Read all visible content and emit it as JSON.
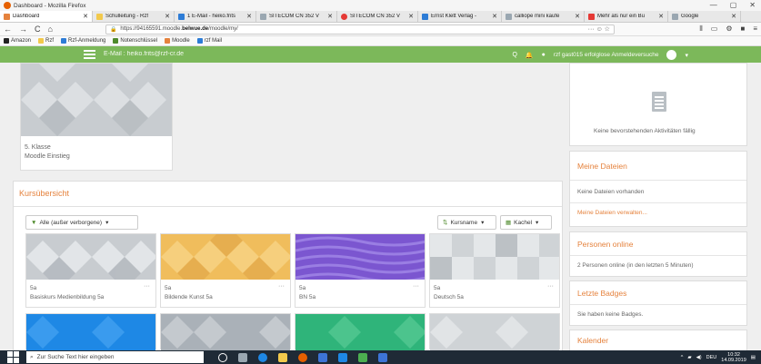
{
  "window": {
    "title": "Dashboard - Mozilla Firefox",
    "controls": [
      "—",
      "▢",
      "✕"
    ]
  },
  "tabs": [
    {
      "label": "Dashboard",
      "color": "#e8e8e8",
      "active": true
    },
    {
      "label": "Schulleitung - Rzf",
      "color": "#f2c94c"
    },
    {
      "label": "1 E-Mail - heiko.frits",
      "color": "#2d7cd6"
    },
    {
      "label": "SITECOM CN 352 V",
      "color": "#9aa7b1"
    },
    {
      "label": "SITECOM CN 352 V",
      "color": "#e53935"
    },
    {
      "label": "Ernst Klett Verlag -",
      "color": "#2d7cd6"
    },
    {
      "label": "calliope mini kaufe",
      "color": "#9aa7b1"
    },
    {
      "label": "Mehr als nur ein Bu",
      "color": "#e53935"
    },
    {
      "label": "Google",
      "color": "#9aa7b1"
    }
  ],
  "nav": {
    "back": "←",
    "forward": "→",
    "reload": "C",
    "home": "⌂",
    "url_prefix": "https://94165591.moodle.",
    "url_domain": "belwue.de",
    "url_suffix": "/moodle/my/",
    "url_ext": "··· ☺ ☆",
    "right_icons": [
      "⫴",
      "▭",
      "⚙",
      "■",
      "≡"
    ]
  },
  "bookmarks": [
    {
      "label": "Amazon",
      "color": "#222"
    },
    {
      "label": "Rzf",
      "color": "#f2c94c"
    },
    {
      "label": "Rzf-Anmeldung",
      "color": "#2d7cd6"
    },
    {
      "label": "Notenschlüssel",
      "color": "#4e8a2b"
    },
    {
      "label": "Moodle",
      "color": "#e5823d"
    },
    {
      "label": "rzf Mail",
      "color": "#2d7cd6"
    }
  ],
  "header": {
    "mail": "E-Mail : heiko.frits@rzf-cr.de",
    "user": "rzf gast015   erfolglose Anmeldeversuche",
    "search_icon": "Q",
    "bell_icon": "🔔",
    "chat_icon": "●",
    "dropdown": "▾"
  },
  "card5": {
    "line1": "5. Klasse",
    "line2": "Moodle Einstieg"
  },
  "overview": {
    "title": "Kursübersicht",
    "filter": "Alle (außer verborgene)",
    "sort": "Kursname",
    "view": "Kachel",
    "caret": "▾",
    "courses": [
      {
        "label1": "5a",
        "label2": "Basiskurs Medienbildung 5a",
        "color": "#c8ccd0",
        "pattern": "diamond"
      },
      {
        "label1": "5a",
        "label2": "Bildende Kunst 5a",
        "color": "#f0bd5c",
        "pattern": "diamond"
      },
      {
        "label1": "5a",
        "label2": "BN 5a",
        "color": "#7b56d0",
        "pattern": "wave"
      },
      {
        "label1": "5a",
        "label2": "Deutsch 5a",
        "color": "#cfd3d6",
        "pattern": "square"
      }
    ],
    "more": [
      {
        "color": "#1e88e5"
      },
      {
        "color": "#aab1b8"
      },
      {
        "color": "#2fb47a"
      },
      {
        "color": "#cfd3d6"
      }
    ]
  },
  "sidebar": {
    "events_text": "Keine bevorstehenden Aktivitäten fällig",
    "files_title": "Meine Dateien",
    "files_text": "Keine Dateien vorhanden",
    "files_link": "Meine Dateien verwalten...",
    "online_title": "Personen online",
    "online_text": "2 Personen online (in den letzten 5 Minuten)",
    "badges_title": "Letzte Badges",
    "badges_text": "Sie haben keine Badges.",
    "calendar_title": "Kalender"
  },
  "taskbar": {
    "search": "Zur Suche Text hier eingeben",
    "apps": [
      {
        "color": "#ffffff"
      },
      {
        "color": "#9aa7b1"
      },
      {
        "color": "#1e88e5"
      },
      {
        "color": "#f2c94c"
      },
      {
        "color": "#e66000"
      },
      {
        "color": "#3d74d6"
      },
      {
        "color": "#1e88e5"
      },
      {
        "color": "#4caf50"
      },
      {
        "color": "#3d74d6"
      }
    ],
    "lang": "DEU",
    "time": "10:32",
    "date": "14.09.2019"
  }
}
